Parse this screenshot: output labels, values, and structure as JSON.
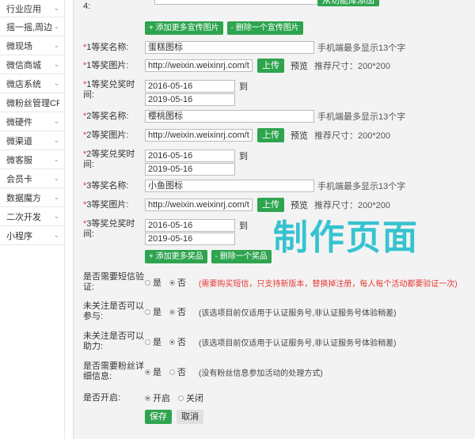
{
  "sidebar": {
    "items": [
      {
        "label": "行业应用"
      },
      {
        "label": "摇一摇,周边"
      },
      {
        "label": "微现场"
      },
      {
        "label": "微信商城"
      },
      {
        "label": "微店系统"
      },
      {
        "label": "微粉丝管理CRM"
      },
      {
        "label": "微硬件"
      },
      {
        "label": "微渠道"
      },
      {
        "label": "微客服"
      },
      {
        "label": "会员卡"
      },
      {
        "label": "数据魔方"
      },
      {
        "label": "二次开发"
      },
      {
        "label": "小程序"
      }
    ]
  },
  "top": {
    "row_label": "4:",
    "library_button": "从功能库添加"
  },
  "promo_buttons": {
    "add": "+ 添加更多宣传图片",
    "delete": "- 删除一个宣传图片"
  },
  "prizes": [
    {
      "name_label": "1等奖名称:",
      "name_value": "蛋糕图标",
      "name_hint": "手机端最多显示13个字",
      "image_label": "1等奖图片:",
      "image_value": "http://weixin.weixinrj.com/t",
      "upload": "上传",
      "preview": "预览",
      "size": "推荐尺寸：200*200",
      "date_label": "1等奖兑奖时间:",
      "date_from": "2016-05-16",
      "date_to_word": "到",
      "date_to": "2019-05-16"
    },
    {
      "name_label": "2等奖名称:",
      "name_value": "樱桃图标",
      "name_hint": "手机端最多显示13个字",
      "image_label": "2等奖图片:",
      "image_value": "http://weixin.weixinrj.com/t",
      "upload": "上传",
      "preview": "预览",
      "size": "推荐尺寸：200*200",
      "date_label": "2等奖兑奖时间:",
      "date_from": "2016-05-16",
      "date_to_word": "到",
      "date_to": "2019-05-16"
    },
    {
      "name_label": "3等奖名称:",
      "name_value": "小鱼图标",
      "name_hint": "手机端最多显示13个字",
      "image_label": "3等奖图片:",
      "image_value": "http://weixin.weixinrj.com/t",
      "upload": "上传",
      "preview": "预览",
      "size": "推荐尺寸：200*200",
      "date_label": "3等奖兑奖时间:",
      "date_from": "2016-05-16",
      "date_to_word": "到",
      "date_to": "2019-05-16"
    }
  ],
  "prize_buttons": {
    "add": "+ 添加更多奖品",
    "delete": "- 删除一个奖品"
  },
  "overlay_text": "制作页面",
  "options": [
    {
      "label": "是否需要短信验证:",
      "yes": "是",
      "no": "否",
      "selected": "no",
      "note": "(需要购买短信，只支持新版本，替换掉注册，每人每个活动都要验证一次)",
      "note_red": true
    },
    {
      "label": "未关注是否可以参与:",
      "yes": "是",
      "no": "否",
      "selected": "no",
      "note": "(该选项目前仅适用于认证服务号,非认证服务号体验稍差)",
      "note_red": false
    },
    {
      "label": "未关注是否可以助力:",
      "yes": "是",
      "no": "否",
      "selected": "no",
      "note": "(该选项目前仅适用于认证服务号,非认证服务号体验稍差)",
      "note_red": false
    },
    {
      "label": "是否需要粉丝详细信息:",
      "yes": "是",
      "no": "否",
      "selected": "yes",
      "note": "(没有粉丝信息参加活动的处理方式)",
      "note_red": false
    }
  ],
  "open": {
    "label": "是否开启:",
    "on": "开启",
    "off": "关闭",
    "selected": "on"
  },
  "actions": {
    "save": "保存",
    "cancel": "取消"
  },
  "colors": {
    "green": "#2ea44f",
    "red": "#e53935",
    "overlay": "#36c3d0"
  }
}
